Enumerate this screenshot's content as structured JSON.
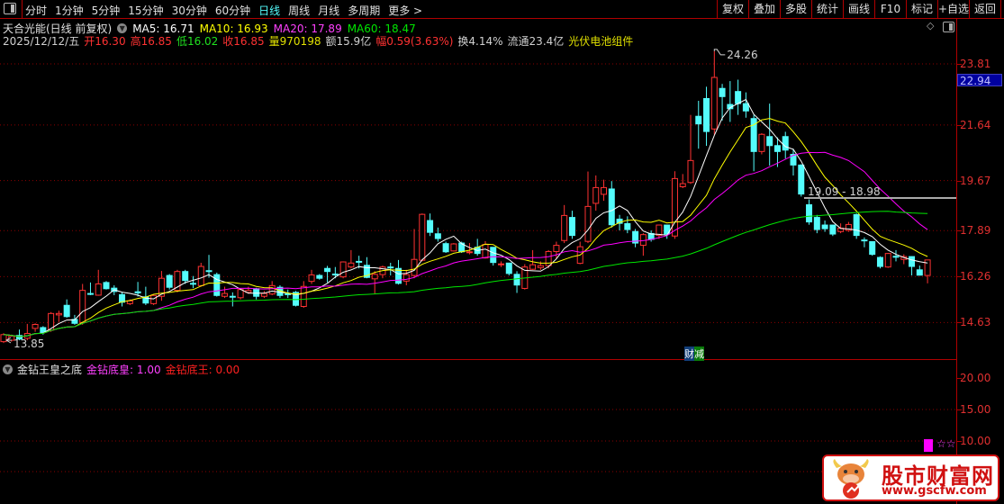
{
  "toolbar": {
    "periods": [
      "分时",
      "1分钟",
      "5分钟",
      "15分钟",
      "30分钟",
      "60分钟",
      "日线",
      "周线",
      "月线",
      "多周期",
      "更多 >"
    ],
    "active_period": "日线",
    "actions": [
      "复权",
      "叠加",
      "多股",
      "统计",
      "画线",
      "F10",
      "标记",
      "+自选",
      "返回"
    ]
  },
  "info": {
    "title": "天合光能(日线 前复权)",
    "ma5": "MA5: 16.71",
    "ma10": "MA10: 16.93",
    "ma20": "MA20: 17.89",
    "ma60": "MA60: 18.47",
    "date": "2025/12/12/五",
    "open": "开16.30",
    "high": "高16.85",
    "low": "低16.02",
    "close": "收16.85",
    "volume": "量970198",
    "amount": "额15.9亿",
    "change": "幅0.59(3.63%)",
    "turnover": "换4.14%",
    "float": "流通23.4亿",
    "sector": "光伏电池组件"
  },
  "colors": {
    "up": "#ff3232",
    "down": "#54fcfc",
    "ma5": "#ffffff",
    "ma10": "#ffff00",
    "ma20": "#ff00ff",
    "ma60": "#00e600",
    "grid": "#8b0000",
    "axis_text": "#e03030",
    "indicator_huang": "#ff40ff",
    "indicator_wang": "#ff2020"
  },
  "axis": {
    "price_ticks": [
      "23.81",
      "21.64",
      "19.67",
      "17.89",
      "16.26",
      "14.63"
    ],
    "current_price": "22.94",
    "indicator_ticks": [
      "20.00",
      "15.00",
      "10.00"
    ]
  },
  "annotations": {
    "high_label": "24.26",
    "low_label": "13.85",
    "range_label": "19.09 - 18.98",
    "range_price": 19.05,
    "event_tag": [
      "财",
      "减"
    ]
  },
  "indicator": {
    "name": "金钻王皇之底",
    "huang": "金钻底皇: 1.00",
    "wang": "金钻底王: 0.00",
    "stars": "☆☆",
    "signal_value": 10
  },
  "watermark": {
    "name": "股市财富网",
    "url": "www.gscfw.com"
  },
  "chart_data": {
    "type": "candlestick",
    "ylim": [
      13.5,
      24.5
    ],
    "series_names": [
      "MA5",
      "MA10",
      "MA20",
      "MA60"
    ],
    "ohlc": [
      [
        13.95,
        14.25,
        13.9,
        14.2
      ],
      [
        14.0,
        14.2,
        13.95,
        14.15
      ],
      [
        14.17,
        14.38,
        14.0,
        14.04
      ],
      [
        14.07,
        14.58,
        14.0,
        14.24
      ],
      [
        14.42,
        14.6,
        14.3,
        14.56
      ],
      [
        14.45,
        14.5,
        14.2,
        14.28
      ],
      [
        14.36,
        15.0,
        14.3,
        14.95
      ],
      [
        14.9,
        15.05,
        14.65,
        14.95
      ],
      [
        15.24,
        15.45,
        14.8,
        14.84
      ],
      [
        14.74,
        14.9,
        14.55,
        14.6
      ],
      [
        14.63,
        16.0,
        14.55,
        15.77
      ],
      [
        15.66,
        16.05,
        15.6,
        15.63
      ],
      [
        15.6,
        16.5,
        15.58,
        16.0
      ],
      [
        16.05,
        16.1,
        15.8,
        15.83
      ],
      [
        15.85,
        15.95,
        15.6,
        15.73
      ],
      [
        15.62,
        15.7,
        15.2,
        15.35
      ],
      [
        15.3,
        15.45,
        15.25,
        15.4
      ],
      [
        15.72,
        16.07,
        15.55,
        15.68
      ],
      [
        15.54,
        15.9,
        15.25,
        15.32
      ],
      [
        15.3,
        15.63,
        15.25,
        15.59
      ],
      [
        15.56,
        16.46,
        15.4,
        16.2
      ],
      [
        16.3,
        16.35,
        15.8,
        15.88
      ],
      [
        15.77,
        16.5,
        15.7,
        16.44
      ],
      [
        16.44,
        16.5,
        16.0,
        16.12
      ],
      [
        16.02,
        16.28,
        15.85,
        16.0
      ],
      [
        15.94,
        16.75,
        15.9,
        16.62
      ],
      [
        16.47,
        17.03,
        16.22,
        16.45
      ],
      [
        16.33,
        16.4,
        15.55,
        15.59
      ],
      [
        15.56,
        15.9,
        15.5,
        15.66
      ],
      [
        15.56,
        15.7,
        15.2,
        15.55
      ],
      [
        15.51,
        15.85,
        15.45,
        15.8
      ],
      [
        15.7,
        15.9,
        15.65,
        15.77
      ],
      [
        15.83,
        15.86,
        15.45,
        15.56
      ],
      [
        15.56,
        15.75,
        15.5,
        15.66
      ],
      [
        15.64,
        16.1,
        15.6,
        15.94
      ],
      [
        15.88,
        15.95,
        15.5,
        15.59
      ],
      [
        15.65,
        15.8,
        15.5,
        15.64
      ],
      [
        15.7,
        15.75,
        15.2,
        15.24
      ],
      [
        15.2,
        16.1,
        15.15,
        15.91
      ],
      [
        16.09,
        16.5,
        16.0,
        16.32
      ],
      [
        16.3,
        16.35,
        16.15,
        16.2
      ],
      [
        16.55,
        16.64,
        16.05,
        16.44
      ],
      [
        16.35,
        16.6,
        16.2,
        16.33
      ],
      [
        16.25,
        16.8,
        16.2,
        16.78
      ],
      [
        16.6,
        17.2,
        16.55,
        16.74
      ],
      [
        16.8,
        17.0,
        16.55,
        16.78
      ],
      [
        16.66,
        16.95,
        16.2,
        16.23
      ],
      [
        16.18,
        16.45,
        15.65,
        16.34
      ],
      [
        16.33,
        16.65,
        16.2,
        16.6
      ],
      [
        16.6,
        16.75,
        16.3,
        16.58
      ],
      [
        16.55,
        16.85,
        15.98,
        16.02
      ],
      [
        16.1,
        16.5,
        15.95,
        16.33
      ],
      [
        16.3,
        17.95,
        16.2,
        16.87
      ],
      [
        16.84,
        18.5,
        16.8,
        18.47
      ],
      [
        18.25,
        18.5,
        17.7,
        17.83
      ],
      [
        17.78,
        18.0,
        17.5,
        17.61
      ],
      [
        17.43,
        17.5,
        17.1,
        17.14
      ],
      [
        17.17,
        17.45,
        17.15,
        17.42
      ],
      [
        17.45,
        17.5,
        17.1,
        17.14
      ],
      [
        17.12,
        17.45,
        17.05,
        17.14
      ],
      [
        17.3,
        17.6,
        17.0,
        17.08
      ],
      [
        16.92,
        17.52,
        16.9,
        17.4
      ],
      [
        17.3,
        17.3,
        16.65,
        16.76
      ],
      [
        16.69,
        16.8,
        16.6,
        16.71
      ],
      [
        16.74,
        16.74,
        16.3,
        16.37
      ],
      [
        16.34,
        16.45,
        15.68,
        15.96
      ],
      [
        15.84,
        16.7,
        15.8,
        16.6
      ],
      [
        16.52,
        17.2,
        16.5,
        16.68
      ],
      [
        16.58,
        16.8,
        16.5,
        16.65
      ],
      [
        16.65,
        17.2,
        16.55,
        17.15
      ],
      [
        17.15,
        17.5,
        16.9,
        17.37
      ],
      [
        17.54,
        18.8,
        17.45,
        18.43
      ],
      [
        18.36,
        18.6,
        17.6,
        17.72
      ],
      [
        16.73,
        17.5,
        16.7,
        17.32
      ],
      [
        17.51,
        19.99,
        17.45,
        18.75
      ],
      [
        18.86,
        19.85,
        18.6,
        19.42
      ],
      [
        19.18,
        19.7,
        18.95,
        19.42
      ],
      [
        19.37,
        19.65,
        18.0,
        18.1
      ],
      [
        18.3,
        18.45,
        17.9,
        18.15
      ],
      [
        18.14,
        18.4,
        17.8,
        17.93
      ],
      [
        17.86,
        17.95,
        17.3,
        17.45
      ],
      [
        17.37,
        17.8,
        17.0,
        17.75
      ],
      [
        17.79,
        17.9,
        17.5,
        17.58
      ],
      [
        17.72,
        18.1,
        17.6,
        18.09
      ],
      [
        18.09,
        18.1,
        17.6,
        17.77
      ],
      [
        17.7,
        20.0,
        17.6,
        19.74
      ],
      [
        19.45,
        19.9,
        19.4,
        19.56
      ],
      [
        19.6,
        22.0,
        19.55,
        20.38
      ],
      [
        21.95,
        22.5,
        20.8,
        21.68
      ],
      [
        22.58,
        23.0,
        20.9,
        21.41
      ],
      [
        21.5,
        24.26,
        21.3,
        23.33
      ],
      [
        22.94,
        23.1,
        21.8,
        22.65
      ],
      [
        22.37,
        23.2,
        21.75,
        22.22
      ],
      [
        22.83,
        23.25,
        22.0,
        22.4
      ],
      [
        22.4,
        22.8,
        21.9,
        22.14
      ],
      [
        21.87,
        22.0,
        20.0,
        20.7
      ],
      [
        20.7,
        21.35,
        20.6,
        21.31
      ],
      [
        21.23,
        22.4,
        20.2,
        20.91
      ],
      [
        20.91,
        21.2,
        20.15,
        20.7
      ],
      [
        21.23,
        21.4,
        20.45,
        20.75
      ],
      [
        20.6,
        20.8,
        19.85,
        20.22
      ],
      [
        20.22,
        20.25,
        19.1,
        19.19
      ],
      [
        18.81,
        19.0,
        18.1,
        18.2
      ],
      [
        18.36,
        18.45,
        17.8,
        17.93
      ],
      [
        18.09,
        18.25,
        17.85,
        17.96
      ],
      [
        18.09,
        18.1,
        17.7,
        17.77
      ],
      [
        17.86,
        18.15,
        17.8,
        17.98
      ],
      [
        17.9,
        18.2,
        17.85,
        18.11
      ],
      [
        18.46,
        18.5,
        17.6,
        17.72
      ],
      [
        17.56,
        17.65,
        17.3,
        17.53
      ],
      [
        17.5,
        17.5,
        17.0,
        17.05
      ],
      [
        16.94,
        16.98,
        16.55,
        16.62
      ],
      [
        16.6,
        17.1,
        16.57,
        17.08
      ],
      [
        16.98,
        17.2,
        16.8,
        16.97
      ],
      [
        16.87,
        17.05,
        16.7,
        16.97
      ],
      [
        16.97,
        16.98,
        16.3,
        16.62
      ],
      [
        16.5,
        16.65,
        16.3,
        16.31
      ],
      [
        16.3,
        16.85,
        16.02,
        16.85
      ]
    ]
  }
}
